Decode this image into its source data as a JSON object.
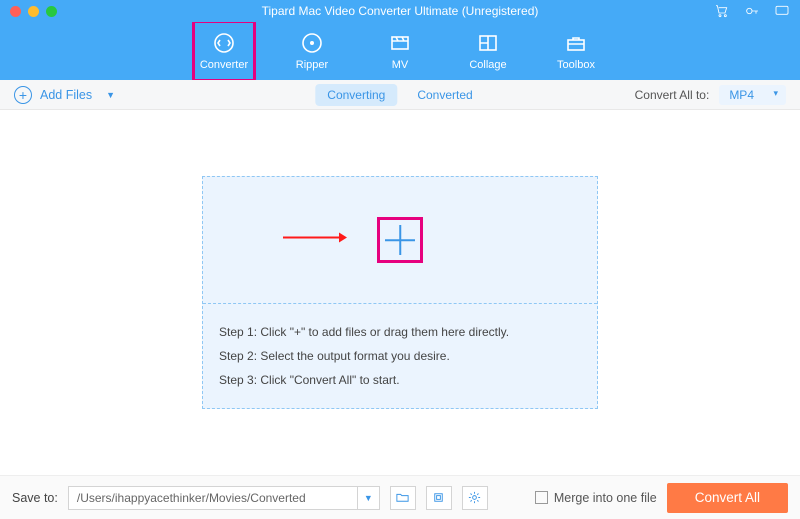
{
  "title": "Tipard Mac Video Converter Ultimate (Unregistered)",
  "nav": [
    {
      "label": "Converter"
    },
    {
      "label": "Ripper"
    },
    {
      "label": "MV"
    },
    {
      "label": "Collage"
    },
    {
      "label": "Toolbox"
    }
  ],
  "toolbar": {
    "add_files": "Add Files",
    "tabs": {
      "converting": "Converting",
      "converted": "Converted"
    },
    "convert_all_to_label": "Convert All to:",
    "convert_all_to_value": "MP4"
  },
  "drop": {
    "step1": "Step 1: Click \"+\" to add files or drag them here directly.",
    "step2": "Step 2: Select the output format you desire.",
    "step3": "Step 3: Click \"Convert All\" to start."
  },
  "bottom": {
    "save_to_label": "Save to:",
    "path": "/Users/ihappyacethinker/Movies/Converted",
    "merge_label": "Merge into one file",
    "convert_all": "Convert All"
  }
}
